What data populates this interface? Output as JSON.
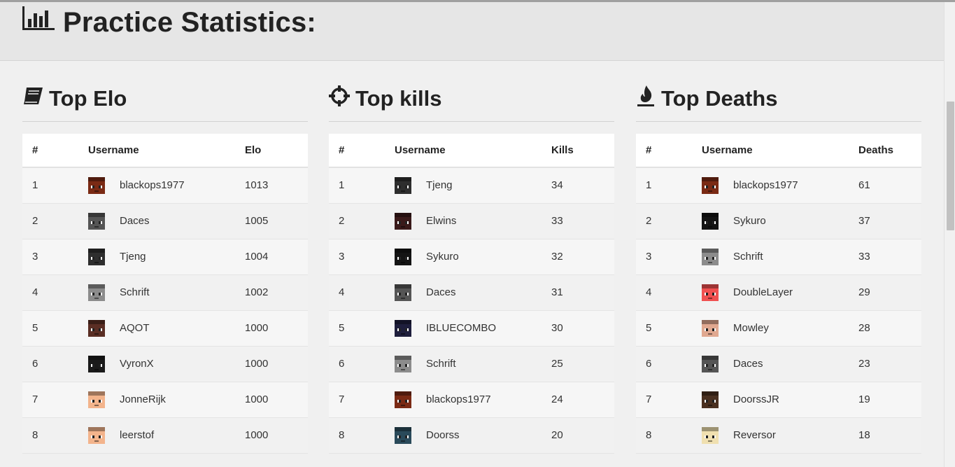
{
  "header": {
    "title": "Practice Statistics:",
    "icon": "bar-chart-icon"
  },
  "columns": [
    {
      "id": "elo",
      "title": "Top Elo",
      "icon": "book-icon",
      "headers": [
        "#",
        "Username",
        "Elo"
      ],
      "rows": [
        {
          "rank": "1",
          "name": "blackops1977",
          "value": "1013",
          "skin": "#7a2a14"
        },
        {
          "rank": "2",
          "name": "Daces",
          "value": "1005",
          "skin": "#555555"
        },
        {
          "rank": "3",
          "name": "Tjeng",
          "value": "1004",
          "skin": "#2e2e2e"
        },
        {
          "rank": "4",
          "name": "Schrift",
          "value": "1002",
          "skin": "#8c8c8c"
        },
        {
          "rank": "5",
          "name": "AQOT",
          "value": "1000",
          "skin": "#5a2e24"
        },
        {
          "rank": "6",
          "name": "VyronX",
          "value": "1000",
          "skin": "#1a1a1a"
        },
        {
          "rank": "7",
          "name": "JonneRijk",
          "value": "1000",
          "skin": "#f3b48c"
        },
        {
          "rank": "8",
          "name": "leerstof",
          "value": "1000",
          "skin": "#f3b48c"
        }
      ]
    },
    {
      "id": "kills",
      "title": "Top kills",
      "icon": "crosshair-icon",
      "headers": [
        "#",
        "Username",
        "Kills"
      ],
      "rows": [
        {
          "rank": "1",
          "name": "Tjeng",
          "value": "34",
          "skin": "#2e2e2e"
        },
        {
          "rank": "2",
          "name": "Elwins",
          "value": "33",
          "skin": "#3a1a1a"
        },
        {
          "rank": "3",
          "name": "Sykuro",
          "value": "32",
          "skin": "#141414"
        },
        {
          "rank": "4",
          "name": "Daces",
          "value": "31",
          "skin": "#555555"
        },
        {
          "rank": "5",
          "name": "IBLUECOMBO",
          "value": "30",
          "skin": "#1e1e3c"
        },
        {
          "rank": "6",
          "name": "Schrift",
          "value": "25",
          "skin": "#8c8c8c"
        },
        {
          "rank": "7",
          "name": "blackops1977",
          "value": "24",
          "skin": "#7a2a14"
        },
        {
          "rank": "8",
          "name": "Doorss",
          "value": "20",
          "skin": "#2a4a5a"
        }
      ]
    },
    {
      "id": "deaths",
      "title": "Top Deaths",
      "icon": "fire-icon",
      "headers": [
        "#",
        "Username",
        "Deaths"
      ],
      "rows": [
        {
          "rank": "1",
          "name": "blackops1977",
          "value": "61",
          "skin": "#7a2a14"
        },
        {
          "rank": "2",
          "name": "Sykuro",
          "value": "37",
          "skin": "#141414"
        },
        {
          "rank": "3",
          "name": "Schrift",
          "value": "33",
          "skin": "#8c8c8c"
        },
        {
          "rank": "4",
          "name": "DoubleLayer",
          "value": "29",
          "skin": "#f05050"
        },
        {
          "rank": "5",
          "name": "Mowley",
          "value": "28",
          "skin": "#e0a890"
        },
        {
          "rank": "6",
          "name": "Daces",
          "value": "23",
          "skin": "#555555"
        },
        {
          "rank": "7",
          "name": "DoorssJR",
          "value": "19",
          "skin": "#4a3020"
        },
        {
          "rank": "8",
          "name": "Reversor",
          "value": "18",
          "skin": "#f0e0b0"
        }
      ]
    }
  ]
}
